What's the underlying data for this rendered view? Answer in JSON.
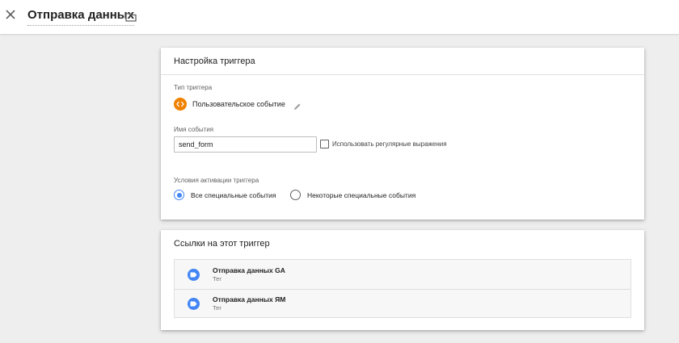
{
  "header": {
    "title": "Отправка данных"
  },
  "trigger_config": {
    "card_title": "Настройка триггера",
    "type_label": "Тип триггера",
    "type_value": "Пользовательское событие",
    "event_name_label": "Имя события",
    "event_name_value": "send_form",
    "regex_label": "Использовать регулярные выражения",
    "regex_checked": false,
    "conditions_label": "Условия активации триггера",
    "options": [
      {
        "label": "Все специальные события",
        "selected": true
      },
      {
        "label": "Некоторые специальные события",
        "selected": false
      }
    ]
  },
  "references": {
    "card_title": "Ссылки на этот триггер",
    "items": [
      {
        "title": "Отправка данных GA",
        "subtitle": "Тег"
      },
      {
        "title": "Отправка данных ЯМ",
        "subtitle": "Тег"
      }
    ]
  },
  "icons": {
    "close": "close-icon",
    "folder": "folder-icon",
    "custom_event": "custom-event-icon",
    "edit": "pencil-icon",
    "tag": "tag-icon"
  },
  "colors": {
    "accent": "#4285f4",
    "trigger_orange": "#f08200",
    "background": "#eeeeee"
  }
}
